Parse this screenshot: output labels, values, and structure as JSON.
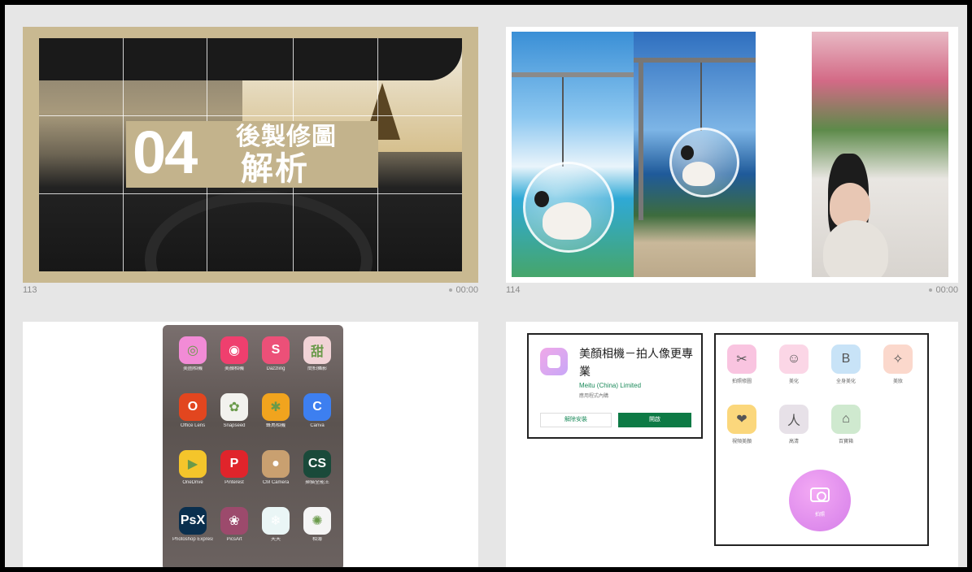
{
  "slides": [
    {
      "number": "113",
      "duration": "00:00",
      "title_number": "04",
      "title_line1": "後製修圖",
      "title_line2": "解析"
    },
    {
      "number": "114",
      "duration": "00:00"
    }
  ],
  "phone_apps": [
    {
      "label": "美圖相機",
      "glyph": "◎",
      "color": "#f28bd6"
    },
    {
      "label": "美顏相機",
      "glyph": "◉",
      "color": "#ef3f6e"
    },
    {
      "label": "Dazzling",
      "glyph": "S",
      "color": "#ec5078"
    },
    {
      "label": "簡拍攝影",
      "glyph": "甜",
      "color": "#f1d3d6"
    },
    {
      "label": "Office Lens",
      "glyph": "O",
      "color": "#e2461f"
    },
    {
      "label": "Snapseed",
      "glyph": "✿",
      "color": "#f2f2ee"
    },
    {
      "label": "蜂鳥相機",
      "glyph": "✱",
      "color": "#f1a41e"
    },
    {
      "label": "Canva",
      "glyph": "C",
      "color": "#3d7ff0"
    },
    {
      "label": "OneDrive",
      "glyph": "▶",
      "color": "#f4c52b"
    },
    {
      "label": "Pinterest",
      "glyph": "P",
      "color": "#e0242b"
    },
    {
      "label": "CM Camera",
      "glyph": "●",
      "color": "#c9a070"
    },
    {
      "label": "掃描全能王",
      "glyph": "CS",
      "color": "#1a4a3a"
    },
    {
      "label": "Photoshop Express",
      "glyph": "PsX",
      "color": "#0a2f4e"
    },
    {
      "label": "PicsArt",
      "glyph": "❀",
      "color": "#9c4a6c"
    },
    {
      "label": "天天",
      "glyph": "❄",
      "color": "#eaf6f6"
    },
    {
      "label": "相簿",
      "glyph": "✺",
      "color": "#f5f5f5"
    }
  ],
  "store_listing": {
    "app_name": "美顏相機－拍人像更專業",
    "developer": "Meitu (China) Limited",
    "sub": "應用程式內購",
    "uninstall_label": "解除安裝",
    "open_label": "開啟"
  },
  "camera_menu": {
    "items": [
      {
        "label": "拍照修圖",
        "glyph": "✂",
        "color": "#f9c4e0"
      },
      {
        "label": "美化",
        "glyph": "☺",
        "color": "#fbd6e6"
      },
      {
        "label": "全身美化",
        "glyph": "B",
        "color": "#c8e3f7"
      },
      {
        "label": "美妝",
        "glyph": "✧",
        "color": "#fbd8cc"
      },
      {
        "label": "視頻美顏",
        "glyph": "❤",
        "color": "#fbd77c"
      },
      {
        "label": "高清",
        "glyph": "人",
        "color": "#e7e1e8"
      },
      {
        "label": "百寶箱",
        "glyph": "⌂",
        "color": "#cfe9cf"
      }
    ],
    "shutter_label": "拍照"
  }
}
